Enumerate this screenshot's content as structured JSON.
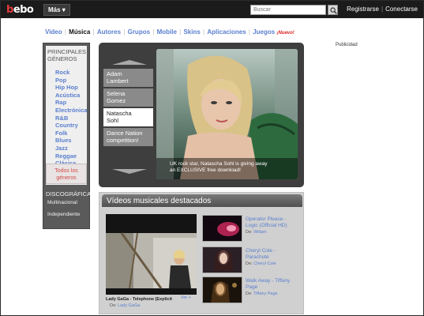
{
  "topbar": {
    "logo": "bebo",
    "mas_label": "Más",
    "search_placeholder": "Buscar",
    "links": [
      "Registrarse",
      "Conectarse"
    ]
  },
  "nav": {
    "items": [
      "Video",
      "Música",
      "Autores",
      "Grupos",
      "Mobile",
      "Skins",
      "Aplicaciones",
      "Juegos"
    ],
    "active": "Música",
    "nuevo": "¡Nuevo!"
  },
  "publicidad": "Publicidad",
  "sidebar": {
    "heading_line1": "PRINCIPALES",
    "heading_line2": "GÉNEROS",
    "genres": [
      "Rock",
      "Pop",
      "Hip Hop",
      "Acústica",
      "Rap",
      "Electrónica",
      "R&B",
      "Country",
      "Folk",
      "Blues",
      "Jazz",
      "Reggae",
      "Clásica"
    ],
    "todos_line1": "Todos los",
    "todos_line2": "géneros",
    "disco_heading": "DISCOGRÁFICA",
    "disco_items": [
      "Multinacional",
      "Independiente"
    ]
  },
  "carousel": {
    "items": [
      {
        "line1": "Adam",
        "line2": "Lambert"
      },
      {
        "line1": "Selena",
        "line2": "Gomez"
      },
      {
        "line1": "Natascha",
        "line2": "Sohl"
      },
      {
        "line1": "Dance Nation",
        "line2": "competition!"
      }
    ],
    "selected_index": 2,
    "caption_line1": "UK rock star, Natascha Sohl is giving away",
    "caption_line2": "an EXCLUSIVE free download!"
  },
  "videos": {
    "title": "Vídeos musicales destacados",
    "main": {
      "title": "Lady GaGa - Telephone (Explicit",
      "more": "Ver +",
      "de_label": "De:",
      "artist": "Lady GaGa"
    },
    "list": [
      {
        "line1": "Operator Please -",
        "line2": "Logic (Official HD)",
        "de_label": "De:",
        "artist": "Willam"
      },
      {
        "line1": "Cheryl Cole -",
        "line2": "Parachute",
        "de_label": "De:",
        "artist": "Cheryl Cole"
      },
      {
        "line1": "Walk Away - Tiffany",
        "line2": "Page",
        "de_label": "De:",
        "artist": "Tiffany Page"
      }
    ]
  },
  "colors": {
    "topbar_bg": "#1b1b1b",
    "link_blue": "#5b7fcf",
    "logo_red": "#e23b3b",
    "panel_dark": "#3e3e3e",
    "sidebar_grey": "#5a5a5a",
    "videos_bg": "#d0d0d0"
  }
}
